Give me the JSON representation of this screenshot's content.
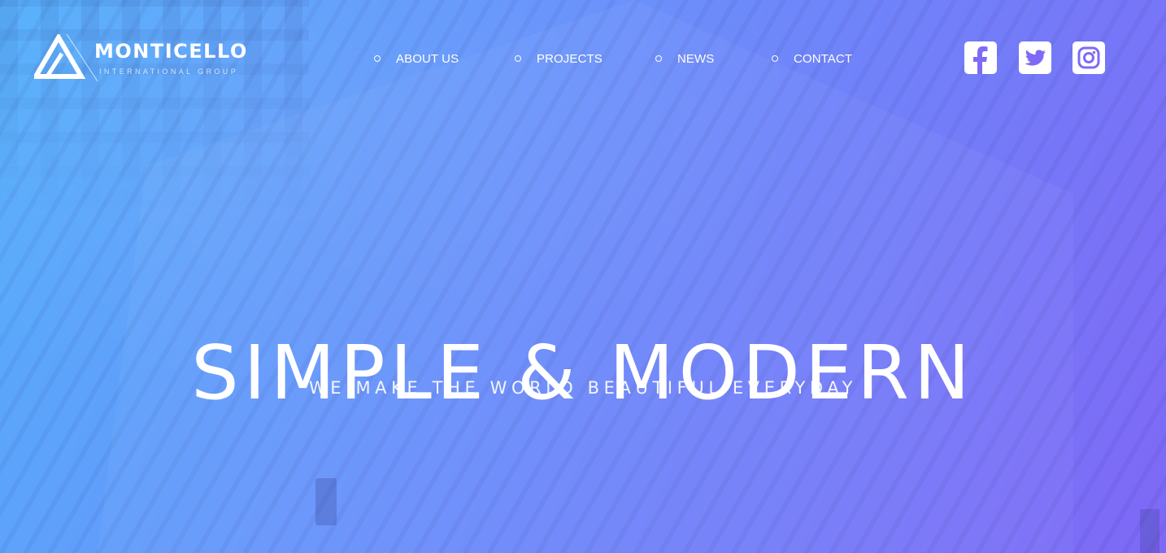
{
  "brand": {
    "name": "MONTICELLO",
    "tagline": "INTERNATIONAL GROUP"
  },
  "nav": {
    "items": [
      {
        "label": "ABOUT US"
      },
      {
        "label": "PROJECTS"
      },
      {
        "label": "NEWS"
      },
      {
        "label": "CONTACT"
      }
    ]
  },
  "social": {
    "icons": [
      "facebook-icon",
      "twitter-icon",
      "instagram-icon"
    ],
    "icon_color": "#7f6af7"
  },
  "hero": {
    "title": "SIMPLE & MODERN",
    "subtitle": "WE MAKE THE WORLD BEAUTIFUL EVERYDAY"
  },
  "colors": {
    "gradient_start": "#54b0fb",
    "gradient_mid": "#6a8ffb",
    "gradient_end": "#7e68f6",
    "text": "#ffffff"
  }
}
